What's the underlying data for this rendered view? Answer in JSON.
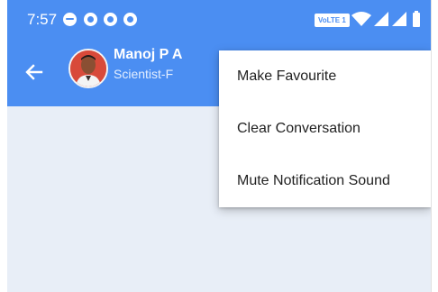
{
  "status_bar": {
    "time": "7:57",
    "notification_icons": [
      "chat-bubble-icon",
      "app-notification-icon",
      "app-notification-icon",
      "app-notification-icon"
    ],
    "network_badge": "VoLTE 1",
    "system_icons": [
      "wifi-icon",
      "signal-icon",
      "signal-icon",
      "battery-icon"
    ]
  },
  "header": {
    "contact_name": "Manoj P A",
    "contact_role": "Scientist-F"
  },
  "overflow_menu": {
    "items": [
      {
        "label": "Make Favourite"
      },
      {
        "label": "Clear Conversation"
      },
      {
        "label": "Mute Notification Sound"
      }
    ]
  },
  "colors": {
    "primary": "#4b8ef2",
    "chat_background": "#e8eef7",
    "menu_background": "#ffffff",
    "menu_text": "#222222"
  }
}
